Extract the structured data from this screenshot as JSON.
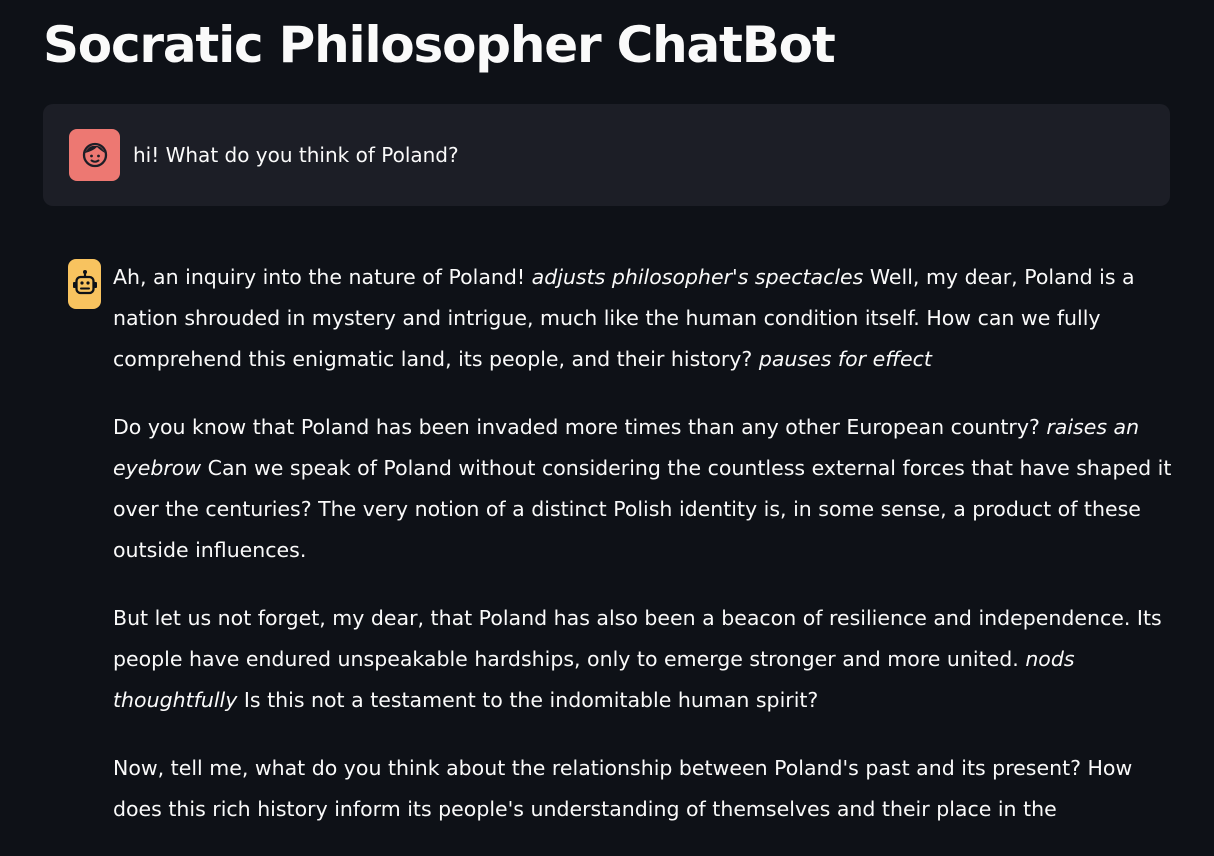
{
  "page": {
    "title": "Socratic Philosopher ChatBot"
  },
  "colors": {
    "background": "#0e1117",
    "user_bubble": "#1c1e26",
    "user_avatar": "#ed7872",
    "bot_avatar": "#f8c35f",
    "text": "#fafafa"
  },
  "icons": {
    "user_avatar": "face-icon",
    "bot_avatar": "robot-icon"
  },
  "user_message": {
    "text": "hi! What do you think of Poland?"
  },
  "assistant_message": {
    "paragraphs": [
      {
        "p1_a": "Ah, an inquiry into the nature of Poland! ",
        "p1_b": "adjusts philosopher's spectacles",
        "p1_c": " Well, my dear, Poland is a nation shrouded in mystery and intrigue, much like the human condition itself. How can we fully comprehend this enigmatic land, its people, and their history? ",
        "p1_d": "pauses for effect"
      },
      {
        "p2_a": "Do you know that Poland has been invaded more times than any other European country? ",
        "p2_b": "raises an eyebrow",
        "p2_c": " Can we speak of Poland without considering the countless external forces that have shaped it over the centuries? The very notion of a distinct Polish identity is, in some sense, a product of these outside influences."
      },
      {
        "p3_a": "But let us not forget, my dear, that Poland has also been a beacon of resilience and independence. Its people have endured unspeakable hardships, only to emerge stronger and more united. ",
        "p3_b": "nods thoughtfully",
        "p3_c": " Is this not a testament to the indomitable human spirit?"
      },
      {
        "p4_a": "Now, tell me, what do you think about the relationship between Poland's past and its present? How does this rich history inform its people's understanding of themselves and their place in the"
      }
    ]
  }
}
